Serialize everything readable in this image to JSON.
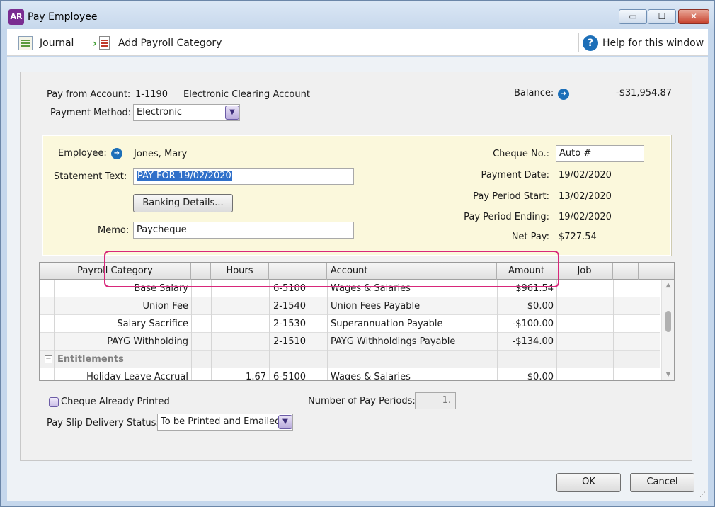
{
  "window": {
    "app_badge": "AR",
    "title": "Pay Employee",
    "min_symbol": "▭",
    "max_symbol": "☐",
    "close_symbol": "✕"
  },
  "toolbar": {
    "journal_label": "Journal",
    "add_category_label": "Add Payroll Category",
    "help_label": "Help for this window",
    "help_symbol": "?"
  },
  "payment": {
    "pay_from_label": "Pay from Account:",
    "account_number": "1-1190",
    "account_name": "Electronic Clearing Account",
    "balance_label": "Balance:",
    "balance_value": "-$31,954.87",
    "method_label": "Payment Method:",
    "method_value": "Electronic"
  },
  "employee": {
    "employee_label": "Employee:",
    "employee_name": "Jones, Mary",
    "statement_label": "Statement Text:",
    "statement_value": "PAY FOR 19/02/2020",
    "banking_button": "Banking Details...",
    "memo_label": "Memo:",
    "memo_value": "Paycheque",
    "cheque_label": "Cheque No.:",
    "cheque_value": "Auto #",
    "payment_date_label": "Payment Date:",
    "payment_date_value": "19/02/2020",
    "period_start_label": "Pay Period Start:",
    "period_start_value": "13/02/2020",
    "period_end_label": "Pay Period Ending:",
    "period_end_value": "19/02/2020",
    "net_pay_label": "Net Pay:",
    "net_pay_value": "$727.54"
  },
  "grid": {
    "headers": [
      "Payroll Category",
      "Hours",
      "Account",
      "Amount",
      "Job"
    ],
    "rows": [
      {
        "category": "Base Salary",
        "hours": "",
        "account_no": "6-5100",
        "account": "Wages & Salaries",
        "amount": "$961.54"
      },
      {
        "category": "Union Fee",
        "hours": "",
        "account_no": "2-1540",
        "account": "Union Fees Payable",
        "amount": "$0.00"
      },
      {
        "category": "Salary Sacrifice",
        "hours": "",
        "account_no": "2-1530",
        "account": "Superannuation Payable",
        "amount": "-$100.00"
      },
      {
        "category": "PAYG Withholding",
        "hours": "",
        "account_no": "2-1510",
        "account": "PAYG Withholdings Payable",
        "amount": "-$134.00"
      }
    ],
    "section_label": "Entitlements",
    "section_toggle": "−",
    "section_rows": [
      {
        "category": "Holiday Leave Accrual",
        "hours": "1.67",
        "account_no": "6-5100",
        "account": "Wages & Salaries",
        "amount": "$0.00"
      }
    ],
    "scroll_up": "▲",
    "scroll_down": "▼"
  },
  "options": {
    "cheque_printed_label": "Cheque Already Printed",
    "periods_label": "Number of Pay Periods:",
    "periods_value": "1.",
    "delivery_label": "Pay Slip Delivery Status:",
    "delivery_value": "To be Printed and Emailed"
  },
  "footer": {
    "ok_label": "OK",
    "cancel_label": "Cancel"
  },
  "colors": {
    "highlight_border": "#d8277a",
    "memo_panel": "#fbf8dc",
    "info_icon": "#1d6fb8"
  }
}
